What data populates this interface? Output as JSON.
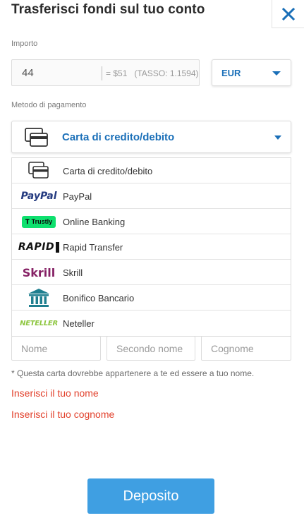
{
  "header": {
    "title": "Trasferisci fondi sul tuo conto",
    "close_icon": "close-icon"
  },
  "amount": {
    "label": "Importo",
    "value": "44",
    "conversion": "= $51   (TASSO: 1.1594)"
  },
  "currency": {
    "selected": "EUR"
  },
  "payment": {
    "label": "Metodo di pagamento",
    "selected": "Carta di credito/debito",
    "options": [
      {
        "label": "Carta di credito/debito",
        "icon": "credit-card-icon"
      },
      {
        "label": "PayPal",
        "logo_text": "PayPal",
        "icon": "paypal-logo"
      },
      {
        "label": "Online Banking",
        "logo_text": "Trustly",
        "icon": "trustly-logo"
      },
      {
        "label": "Rapid Transfer",
        "logo_text": "RAPID",
        "icon": "rapid-transfer-logo"
      },
      {
        "label": "Skrill",
        "logo_text": "Skrill",
        "icon": "skrill-logo"
      },
      {
        "label": "Bonifico Bancario",
        "icon": "bank-icon"
      },
      {
        "label": "Neteller",
        "logo_text": "NETELLER",
        "icon": "neteller-logo"
      }
    ]
  },
  "name_fields": {
    "first_placeholder": "Nome",
    "middle_placeholder": "Secondo nome",
    "last_placeholder": "Cognome"
  },
  "note": "* Questa carta dovrebbe appartenere a te ed essere a tuo nome.",
  "errors": {
    "first_name": "Inserisci il tuo nome",
    "last_name": "Inserisci il tuo cognome"
  },
  "deposit_button": "Deposito",
  "colors": {
    "accent": "#1a6fb8",
    "button": "#3f9fe2",
    "error": "#e2412c",
    "paypal_dark": "#253b80",
    "paypal_light": "#179bd7",
    "trustly": "#0ee06e",
    "skrill": "#862165",
    "bank": "#1f7f8f",
    "neteller": "#8dc63f"
  }
}
